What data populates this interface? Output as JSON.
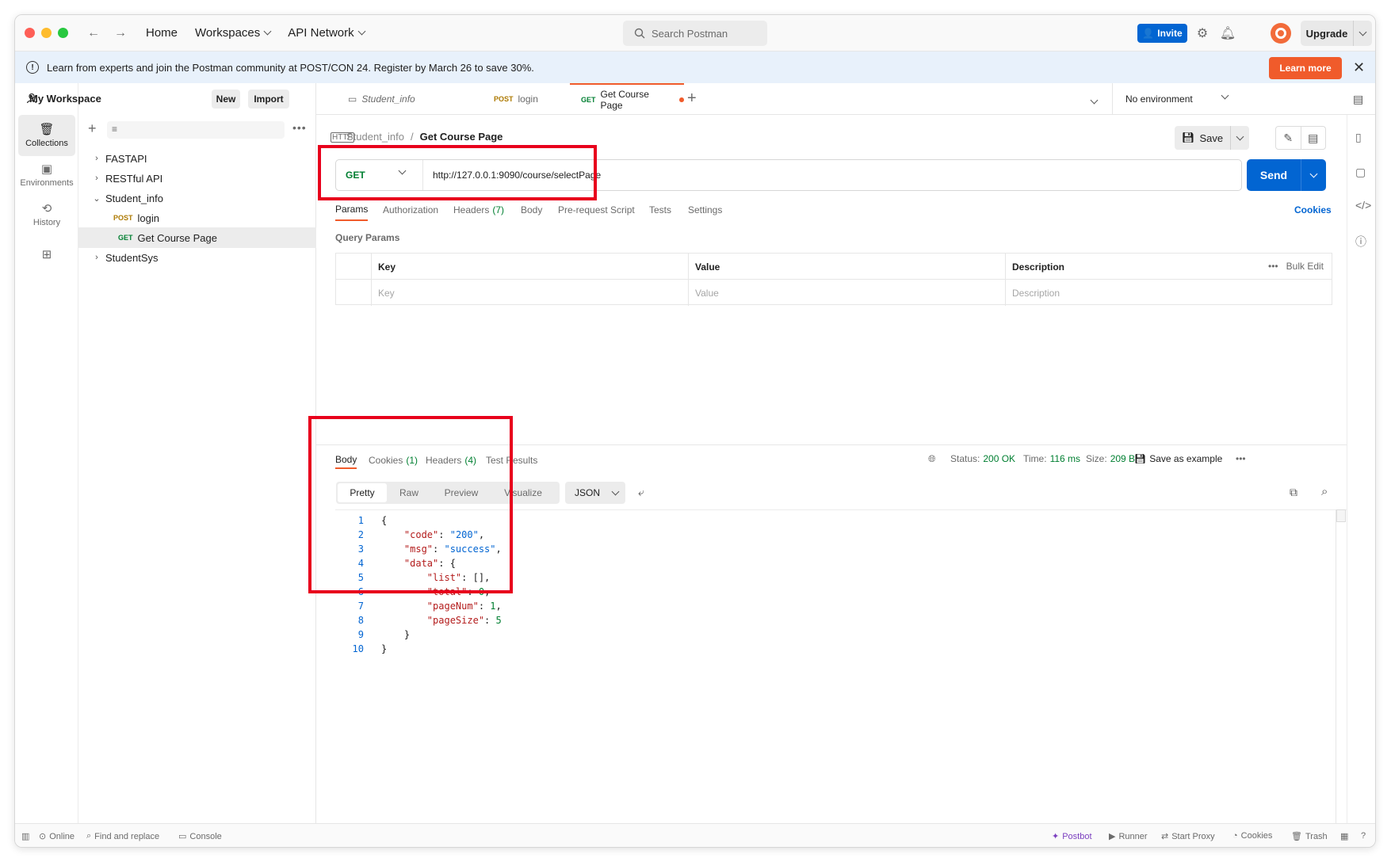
{
  "titlebar": {
    "nav": [
      "Home",
      "Workspaces",
      "API Network"
    ],
    "search_placeholder": "Search Postman",
    "invite_label": "Invite",
    "upgrade_label": "Upgrade"
  },
  "banner": {
    "message": "Learn from experts and join the Postman community at POST/CON 24. Register by March 26 to save 30%.",
    "learn_more": "Learn more"
  },
  "rail": {
    "collections": "Collections",
    "environments": "Environments",
    "history": "History"
  },
  "sidebar": {
    "workspace": "My Workspace",
    "new_label": "New",
    "import_label": "Import",
    "tree": [
      {
        "label": "FASTAPI",
        "arrow": "›"
      },
      {
        "label": "RESTful API",
        "arrow": "›"
      },
      {
        "label": "Student_info",
        "arrow": "⌄"
      },
      {
        "method": "POST",
        "label": "login"
      },
      {
        "method": "GET",
        "label": "Get Course Page"
      },
      {
        "label": "StudentSys",
        "arrow": "›"
      }
    ]
  },
  "tabs": {
    "items": [
      {
        "label": "Student_info"
      },
      {
        "method": "POST",
        "label": "login"
      },
      {
        "method": "GET",
        "label": "Get Course Page"
      }
    ],
    "environment": "No environment"
  },
  "request": {
    "breadcrumb_collection": "Student_info",
    "breadcrumb_separator": "/",
    "name": "Get Course Page",
    "save_label": "Save",
    "method": "GET",
    "url": "http://127.0.0.1:9090/course/selectPage",
    "send_label": "Send",
    "tabs": [
      "Params",
      "Authorization",
      "Headers",
      "Body",
      "Pre-request Script",
      "Tests",
      "Settings"
    ],
    "headers_count": "(7)",
    "cookies_label": "Cookies",
    "query_params_title": "Query Params",
    "columns": [
      "Key",
      "Value",
      "Description"
    ],
    "bulk_edit": "Bulk Edit",
    "placeholders": {
      "key": "Key",
      "value": "Value",
      "description": "Description"
    }
  },
  "response": {
    "tabs": [
      "Body",
      "Cookies",
      "Headers",
      "Test Results"
    ],
    "cookies_count": "(1)",
    "headers_count": "(4)",
    "status_label": "Status:",
    "status_value": "200 OK",
    "time_label": "Time:",
    "time_value": "116 ms",
    "size_label": "Size:",
    "size_value": "209 B",
    "save_example": "Save as example",
    "views": [
      "Pretty",
      "Raw",
      "Preview",
      "Visualize"
    ],
    "format": "JSON",
    "line_numbers": [
      "1",
      "2",
      "3",
      "4",
      "5",
      "6",
      "7",
      "8",
      "9",
      "10"
    ]
  },
  "statusbar": {
    "online": "Online",
    "find_replace": "Find and replace",
    "console": "Console",
    "postbot": "Postbot",
    "runner": "Runner",
    "start_proxy": "Start Proxy",
    "cookies": "Cookies",
    "trash": "Trash"
  },
  "colors": {
    "accent": "#f05b2b",
    "primary": "#0265d2",
    "get_method": "#007f31",
    "post_method": "#ad7a03",
    "annotation": "#e8001c"
  }
}
